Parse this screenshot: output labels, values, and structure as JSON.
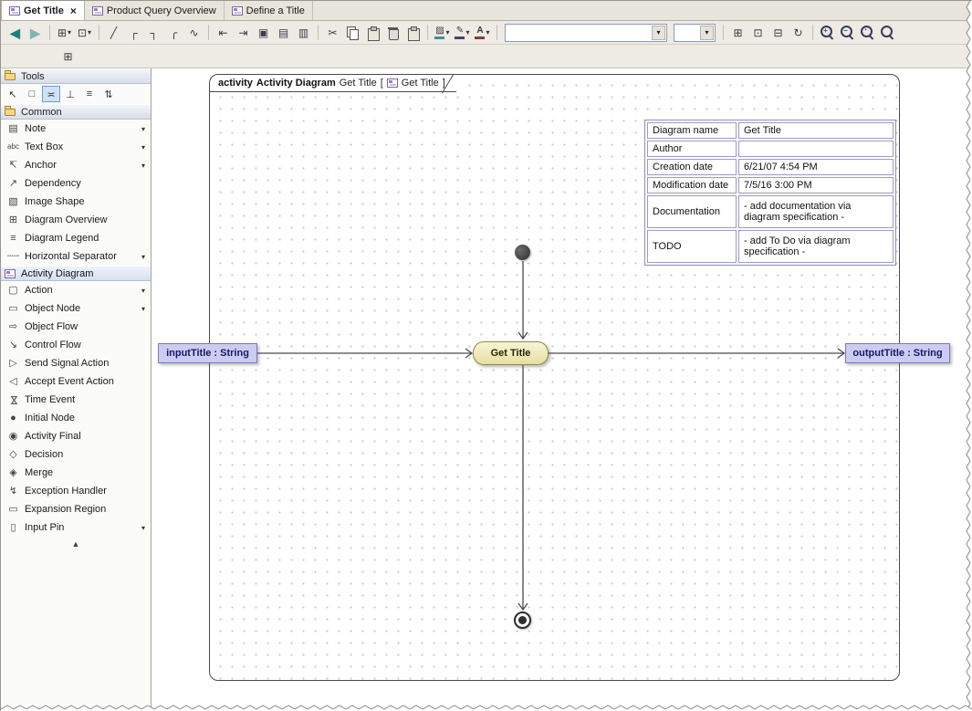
{
  "tabs": {
    "items": [
      {
        "label": "Get Title",
        "close_glyph": "×"
      },
      {
        "label": "Product Query Overview"
      },
      {
        "label": "Define a Title"
      }
    ]
  },
  "toolbar": {
    "caret": "▾",
    "back_glyph": "◀",
    "forward_glyph": "▶",
    "diagram_tree_glyph": "⊞",
    "related_elements_glyph": "⊡",
    "path_oblique_glyph": "╱",
    "path_rectilinear_glyph": "┌",
    "path_bent_glyph": "┐",
    "path_rounded_glyph": "╭",
    "path_spline_glyph": "∿",
    "swimlane_glyph": "⇤",
    "partition_glyph": "⇥",
    "align_glyph": "▣",
    "distribute_glyph": "▤",
    "same_size_glyph": "▥",
    "cut_glyph": "✂",
    "fill_color_glyph": "▨",
    "line_color_glyph": "✎",
    "font_color_glyph": "A",
    "zoom_combo_value": "",
    "style_combo_value": "",
    "save_image_glyph": "⊞",
    "add_favorites_glyph": "⊡",
    "grid_glyph": "⊟",
    "refresh_glyph": "↻",
    "zoom_in_sign": "+",
    "zoom_out_sign": "−",
    "zoom_fit_sign": "▪",
    "zoom_reset_sign": ""
  },
  "toolbar2": {
    "containment_glyph": "⊞"
  },
  "palette": {
    "tools_header": "Tools",
    "common_header": "Common",
    "tools": [
      {
        "name": "select",
        "glyph": "↖"
      },
      {
        "name": "group-select",
        "glyph": "□"
      },
      {
        "name": "snap-link",
        "glyph": "≍"
      },
      {
        "name": "align-bottom",
        "glyph": "⊥"
      },
      {
        "name": "distribute",
        "glyph": "≡"
      },
      {
        "name": "reorder",
        "glyph": "⇅"
      }
    ],
    "common_items": [
      {
        "label": "Note",
        "glyph": "▤",
        "caret": "▾"
      },
      {
        "label": "Text Box",
        "glyph": "abc",
        "caret": "▾"
      },
      {
        "label": "Anchor",
        "glyph": "↸",
        "caret": "▾"
      },
      {
        "label": "Dependency",
        "glyph": "↗"
      },
      {
        "label": "Image Shape",
        "glyph": "▧"
      },
      {
        "label": "Diagram Overview",
        "glyph": "⊞"
      },
      {
        "label": "Diagram Legend",
        "glyph": "≡"
      },
      {
        "label": "Horizontal Separator",
        "glyph": "┄┄",
        "caret": "▾"
      }
    ],
    "section": {
      "label": "Activity Diagram"
    },
    "activity_items": [
      {
        "label": "Action",
        "glyph": "▢",
        "caret": "▾"
      },
      {
        "label": "Object Node",
        "glyph": "▭",
        "caret": "▾"
      },
      {
        "label": "Object Flow",
        "glyph": "⇨"
      },
      {
        "label": "Control Flow",
        "glyph": "↘"
      },
      {
        "label": "Send Signal Action",
        "glyph": "▷"
      },
      {
        "label": "Accept Event Action",
        "glyph": "◁"
      },
      {
        "label": "Time Event",
        "glyph": "⋈"
      },
      {
        "label": "Initial Node",
        "glyph": "●"
      },
      {
        "label": "Activity Final",
        "glyph": "◉"
      },
      {
        "label": "Decision",
        "glyph": "◇"
      },
      {
        "label": "Merge",
        "glyph": "◈"
      },
      {
        "label": "Exception Handler",
        "glyph": "↯"
      },
      {
        "label": "Expansion Region",
        "glyph": "▭"
      },
      {
        "label": "Input Pin",
        "glyph": "▯",
        "caret": "▾"
      }
    ],
    "collapse_glyph": "▲"
  },
  "canvas": {
    "frame": {
      "keyword": "activity",
      "dtype": "Activity Diagram",
      "name": "Get Title",
      "open_bracket": "[",
      "ref": "Get Title",
      "close_bracket": "]"
    },
    "info_table": {
      "rows": [
        {
          "label": "Diagram name",
          "value": "Get Title"
        },
        {
          "label": "Author",
          "value": ""
        },
        {
          "label": "Creation date",
          "value": "6/21/07 4:54 PM"
        },
        {
          "label": "Modification date",
          "value": "7/5/16 3:00 PM"
        },
        {
          "label": "Documentation",
          "value": "- add documentation via diagram specification -"
        },
        {
          "label": "TODO",
          "value": "- add To Do via diagram specification -"
        }
      ]
    },
    "action_label": "Get Title",
    "input_object": "inputTitle : String",
    "output_object": "outputTitle : String"
  },
  "colors": {
    "action_fill": "#f2edc0",
    "action_border": "#8f8a50",
    "object_node_fill": "#ccccf2",
    "object_node_border": "#7878bc",
    "object_node_text": "#17176b",
    "edge": "#4a4a4a",
    "palette_selected": "#cfe3f6",
    "toolbar_bg": "#edebe4",
    "teal_arrow": "#1d7f7f"
  }
}
